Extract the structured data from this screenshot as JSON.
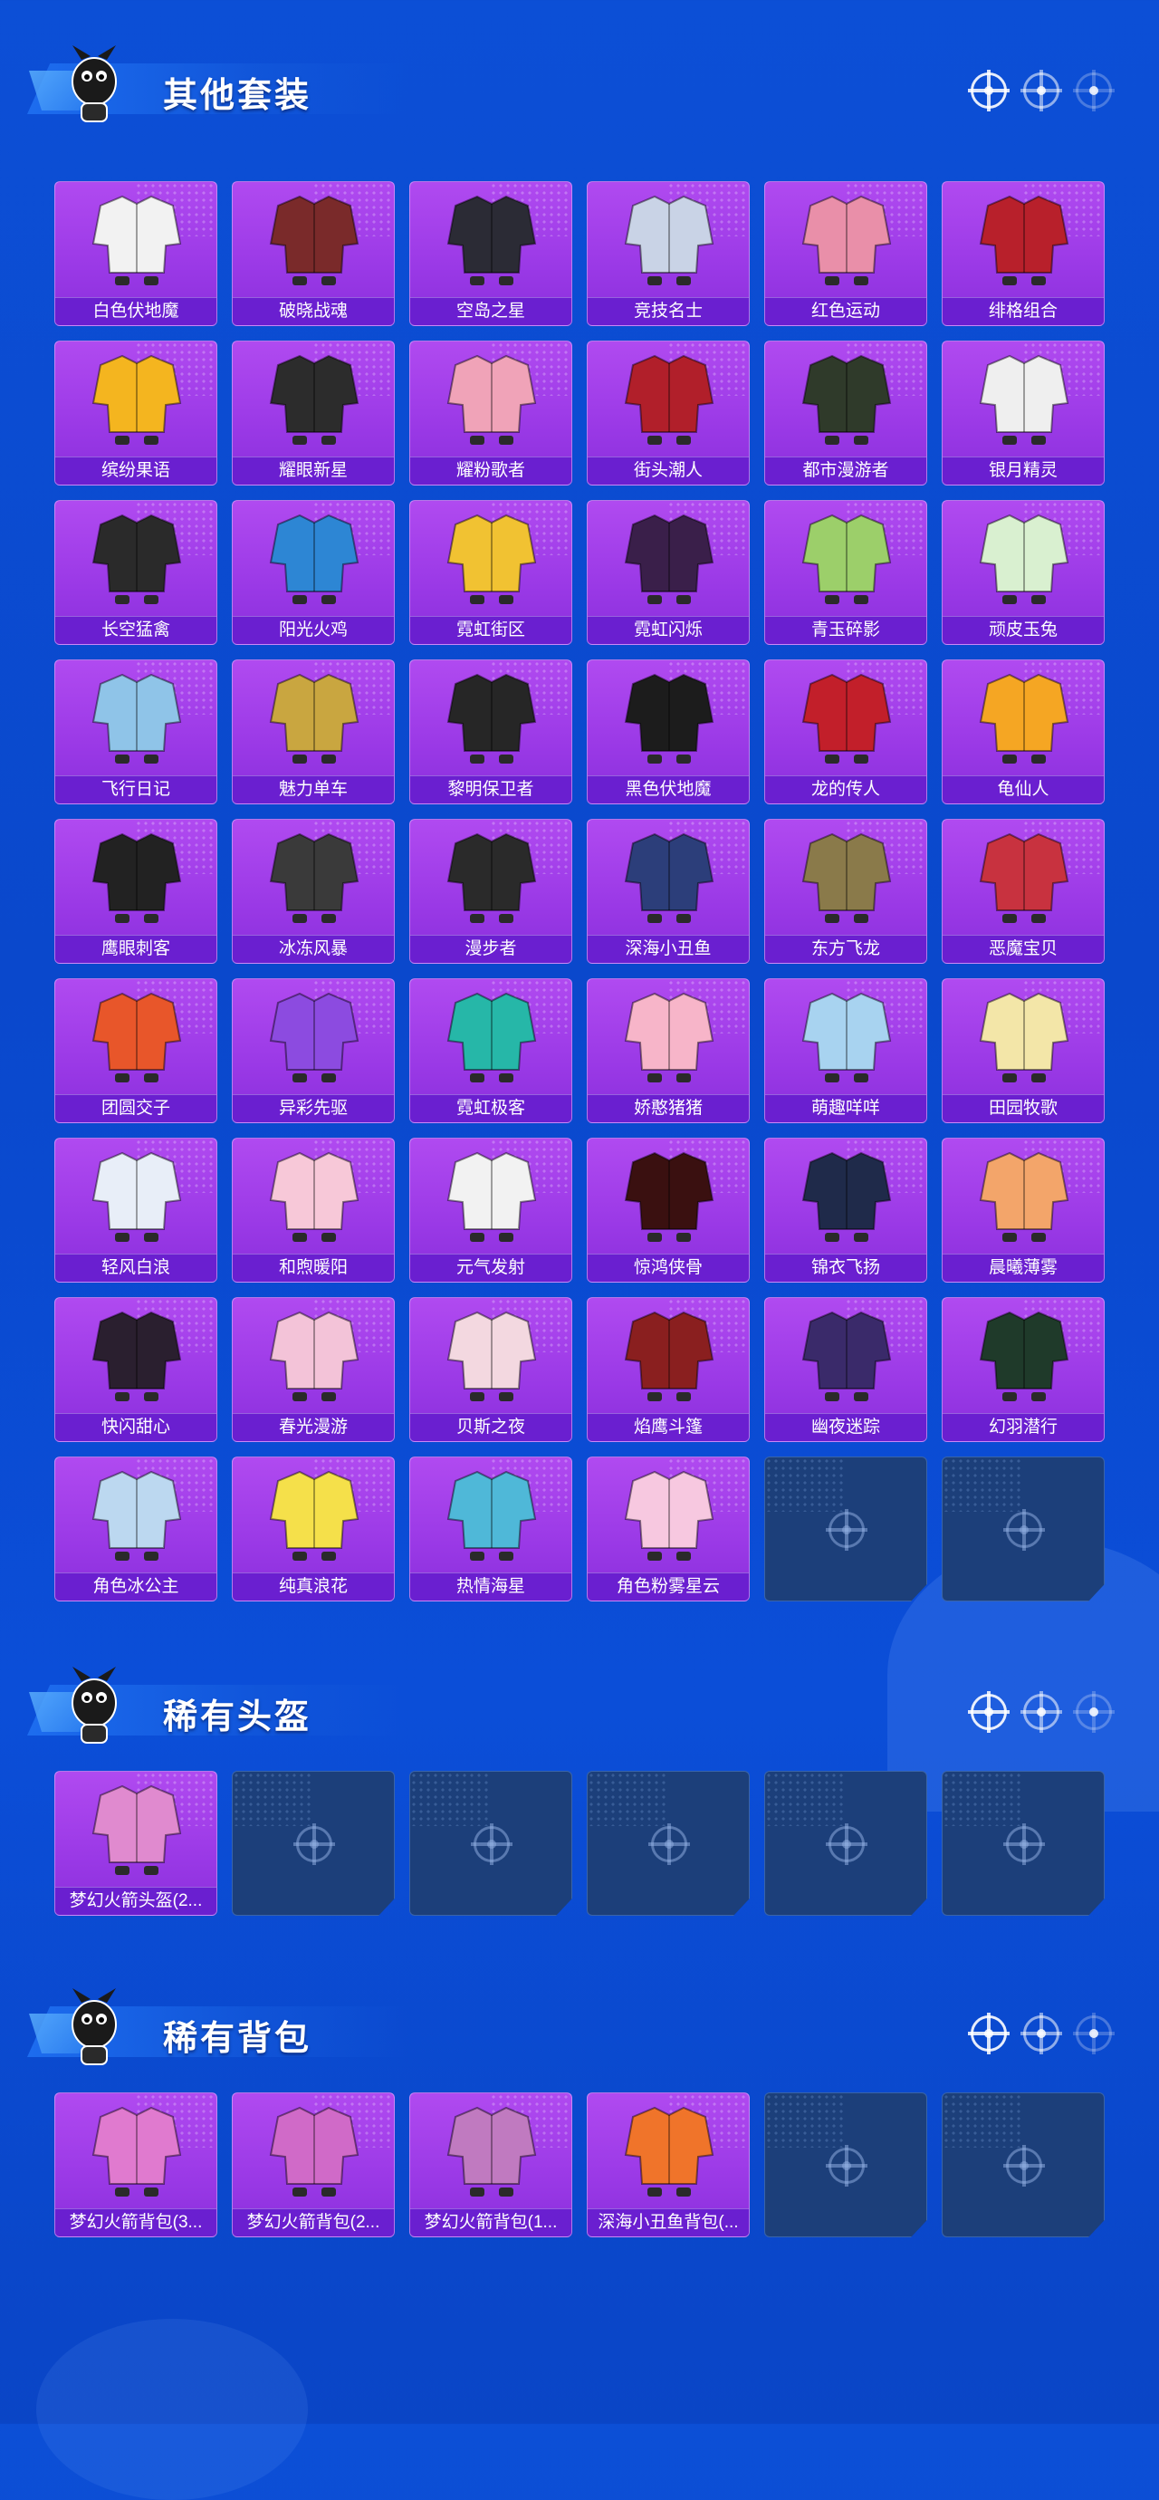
{
  "sections": [
    {
      "title": "其他套装",
      "items": [
        {
          "name": "白色伏地魔",
          "color": "#f2f2f2"
        },
        {
          "name": "破晓战魂",
          "color": "#7a2a2a"
        },
        {
          "name": "空岛之星",
          "color": "#2b2b35"
        },
        {
          "name": "竞技名士",
          "color": "#c9d3e6"
        },
        {
          "name": "红色运动",
          "color": "#e98fa9"
        },
        {
          "name": "绯格组合",
          "color": "#b8202b"
        },
        {
          "name": "缤纷果语",
          "color": "#f4b51f"
        },
        {
          "name": "耀眼新星",
          "color": "#2c2c2c"
        },
        {
          "name": "耀粉歌者",
          "color": "#f0a3b8"
        },
        {
          "name": "街头潮人",
          "color": "#b11f2a"
        },
        {
          "name": "都市漫游者",
          "color": "#2f3a2a"
        },
        {
          "name": "银月精灵",
          "color": "#efefef"
        },
        {
          "name": "长空猛禽",
          "color": "#2a2a2a"
        },
        {
          "name": "阳光火鸡",
          "color": "#2d86d4"
        },
        {
          "name": "霓虹街区",
          "color": "#f1c232"
        },
        {
          "name": "霓虹闪烁",
          "color": "#3a1f4a"
        },
        {
          "name": "青玉碎影",
          "color": "#9ccf6a"
        },
        {
          "name": "顽皮玉兔",
          "color": "#d9f0d0"
        },
        {
          "name": "飞行日记",
          "color": "#8fc4e8"
        },
        {
          "name": "魅力单车",
          "color": "#c9a640"
        },
        {
          "name": "黎明保卫者",
          "color": "#262626"
        },
        {
          "name": "黑色伏地魔",
          "color": "#1c1c1c"
        },
        {
          "name": "龙的传人",
          "color": "#c21f2a"
        },
        {
          "name": "龟仙人",
          "color": "#f5a623"
        },
        {
          "name": "鹰眼刺客",
          "color": "#222222"
        },
        {
          "name": "冰冻风暴",
          "color": "#3a3a3a"
        },
        {
          "name": "漫步者",
          "color": "#2a2a2a"
        },
        {
          "name": "深海小丑鱼",
          "color": "#2c3e7a"
        },
        {
          "name": "东方飞龙",
          "color": "#8a7a4a"
        },
        {
          "name": "恶魔宝贝",
          "color": "#c8323f"
        },
        {
          "name": "团圆交子",
          "color": "#e8562a"
        },
        {
          "name": "异彩先驱",
          "color": "#8c4be0"
        },
        {
          "name": "霓虹极客",
          "color": "#26b7a8"
        },
        {
          "name": "娇憨猪猪",
          "color": "#f7b5c9"
        },
        {
          "name": "萌趣咩咩",
          "color": "#a8d3f0"
        },
        {
          "name": "田园牧歌",
          "color": "#f3e6a8"
        },
        {
          "name": "轻风白浪",
          "color": "#e8eef8"
        },
        {
          "name": "和煦暖阳",
          "color": "#f7c8d8"
        },
        {
          "name": "元气发射",
          "color": "#f2f2f2"
        },
        {
          "name": "惊鸿侠骨",
          "color": "#3a1010"
        },
        {
          "name": "锦衣飞扬",
          "color": "#1f2a4a"
        },
        {
          "name": "晨曦薄雾",
          "color": "#f3a56a"
        },
        {
          "name": "快闪甜心",
          "color": "#2a1f2f"
        },
        {
          "name": "春光漫游",
          "color": "#f3c3d8"
        },
        {
          "name": "贝斯之夜",
          "color": "#f3d8e0"
        },
        {
          "name": "焰鹰斗篷",
          "color": "#8a1f1f"
        },
        {
          "name": "幽夜迷踪",
          "color": "#3a2a6a"
        },
        {
          "name": "幻羽潜行",
          "color": "#1f3a2a"
        },
        {
          "name": "角色冰公主",
          "color": "#bcd8f0"
        },
        {
          "name": "纯真浪花",
          "color": "#f5e04a"
        },
        {
          "name": "热情海星",
          "color": "#4fb8d8"
        },
        {
          "name": "角色粉雾星云",
          "color": "#f7c8e0"
        },
        {
          "name": "",
          "color": ""
        },
        {
          "name": "",
          "color": ""
        }
      ]
    },
    {
      "title": "稀有头盔",
      "items": [
        {
          "name": "梦幻火箭头盔(2...",
          "color": "#e08acf"
        },
        {
          "name": "",
          "color": ""
        },
        {
          "name": "",
          "color": ""
        },
        {
          "name": "",
          "color": ""
        },
        {
          "name": "",
          "color": ""
        },
        {
          "name": "",
          "color": ""
        }
      ]
    },
    {
      "title": "稀有背包",
      "items": [
        {
          "name": "梦幻火箭背包(3...",
          "color": "#e07acf"
        },
        {
          "name": "梦幻火箭背包(2...",
          "color": "#d06ac8"
        },
        {
          "name": "梦幻火箭背包(1...",
          "color": "#c07ac0"
        },
        {
          "name": "深海小丑鱼背包(...",
          "color": "#f0742a"
        },
        {
          "name": "",
          "color": ""
        },
        {
          "name": "",
          "color": ""
        }
      ]
    }
  ]
}
